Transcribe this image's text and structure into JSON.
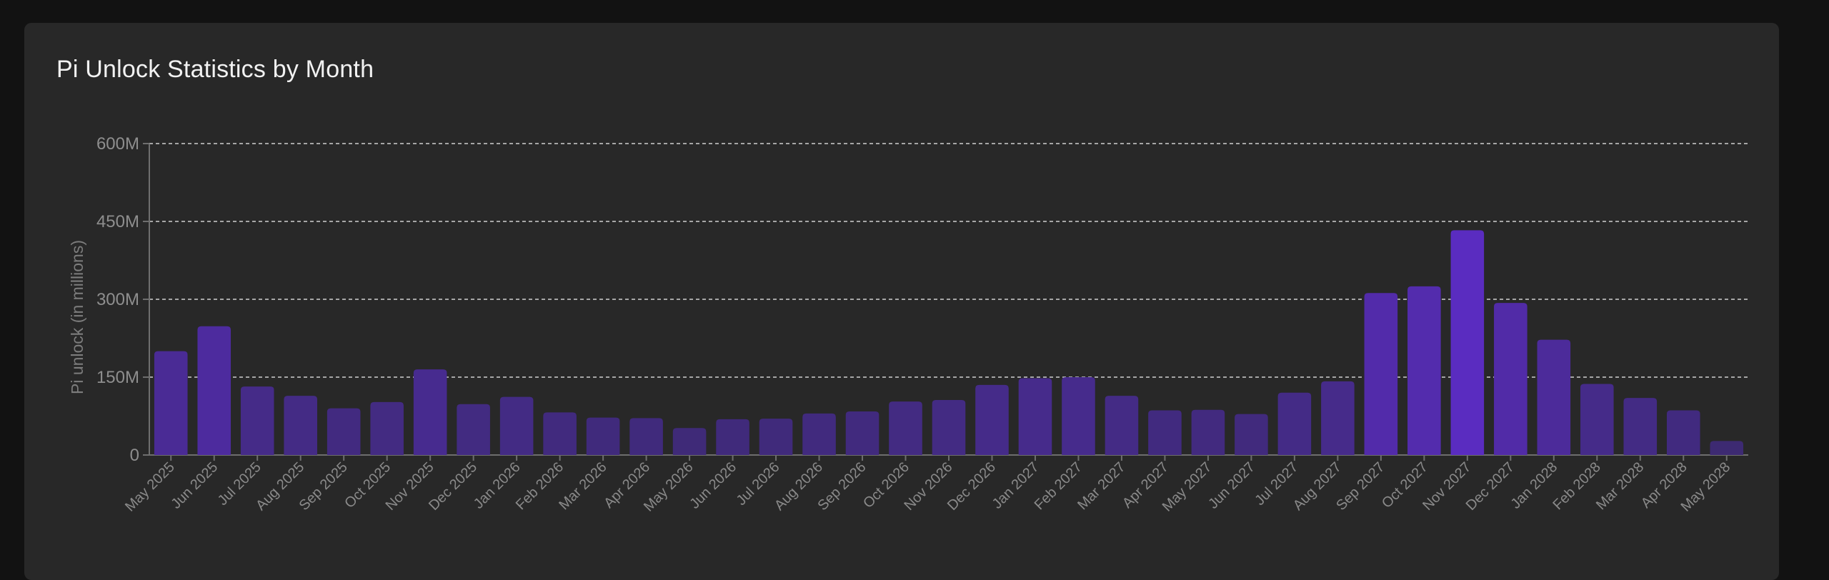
{
  "card": {
    "title": "Pi Unlock Statistics by Month"
  },
  "chart_data": {
    "type": "bar",
    "title": "Pi Unlock Statistics by Month",
    "xlabel": "",
    "ylabel": "Pi unlock (in millions)",
    "ylim": [
      0,
      600
    ],
    "yticks": [
      0,
      150,
      300,
      450,
      600
    ],
    "ytick_labels": [
      "0",
      "150M",
      "300M",
      "450M",
      "600M"
    ],
    "grid": "horizontal-dashed",
    "bar_color_low": "#3a2a6b",
    "bar_color_high": "#5a2cc0",
    "categories": [
      "May 2025",
      "Jun 2025",
      "Jul 2025",
      "Aug 2025",
      "Sep 2025",
      "Oct 2025",
      "Nov 2025",
      "Dec 2025",
      "Jan 2026",
      "Feb 2026",
      "Mar 2026",
      "Apr 2026",
      "May 2026",
      "Jun 2026",
      "Jul 2026",
      "Aug 2026",
      "Sep 2026",
      "Oct 2026",
      "Nov 2026",
      "Dec 2026",
      "Jan 2027",
      "Feb 2027",
      "Mar 2027",
      "Apr 2027",
      "May 2027",
      "Jun 2027",
      "Jul 2027",
      "Aug 2027",
      "Sep 2027",
      "Oct 2027",
      "Nov 2027",
      "Dec 2027",
      "Jan 2028",
      "Feb 2028",
      "Mar 2028",
      "Apr 2028",
      "May 2028"
    ],
    "values": [
      200,
      248,
      132,
      114,
      90,
      102,
      165,
      98,
      112,
      82,
      72,
      71,
      52,
      69,
      70,
      80,
      84,
      103,
      106,
      135,
      148,
      150,
      114,
      86,
      87,
      79,
      120,
      142,
      312,
      325,
      433,
      293,
      222,
      137,
      110,
      86,
      27
    ]
  }
}
